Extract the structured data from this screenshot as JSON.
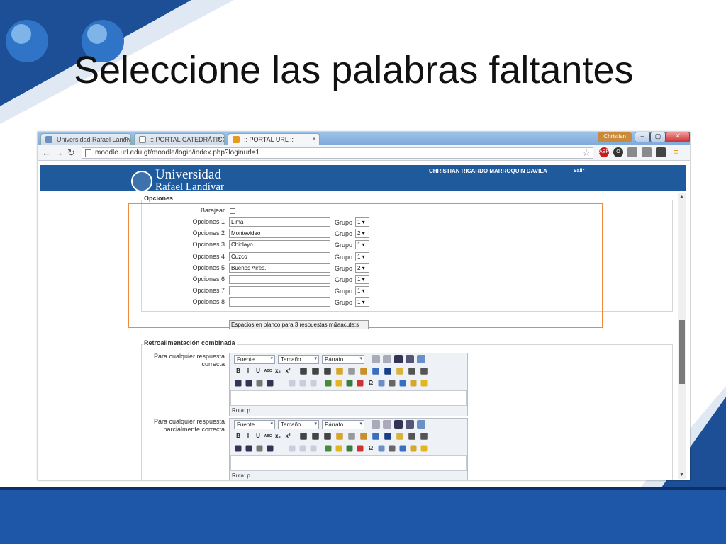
{
  "slide": {
    "title": "Seleccione las palabras faltantes",
    "colors": {
      "band": "#1f57a8",
      "accent_box": "#ee8a3b"
    }
  },
  "browser": {
    "tabs": [
      {
        "label": "Universidad Rafael Landív",
        "icon": "university-favicon-icon"
      },
      {
        "label": ":: PORTAL CATEDRÁTICOS",
        "icon": "page-favicon-icon"
      },
      {
        "label": ":: PORTAL URL ::",
        "icon": "moodle-favicon-icon"
      }
    ],
    "window_user": "Christian",
    "url": "moodle.url.edu.gt/moodle/login/index.php?loginurl=1",
    "extensions": [
      "ABP"
    ]
  },
  "site": {
    "logo_line1": "Universidad",
    "logo_line2": "Rafael Landívar",
    "user_name": "CHRISTIAN RICARDO MARROQUIN DAVILA",
    "logout": "Salir"
  },
  "opciones": {
    "legend": "Opciones",
    "shuffle_label": "Barajear",
    "rows": [
      {
        "label": "Opciones 1",
        "value": "Lima",
        "group_label": "Grupo",
        "group": "1 ▾"
      },
      {
        "label": "Opciones 2",
        "value": "Montevideo",
        "group_label": "Grupo",
        "group": "2 ▾"
      },
      {
        "label": "Opciones 3",
        "value": "Chiclayo",
        "group_label": "Grupo",
        "group": "1 ▾"
      },
      {
        "label": "Opciones 4",
        "value": "Cuzco",
        "group_label": "Grupo",
        "group": "1 ▾"
      },
      {
        "label": "Opciones 5",
        "value": "Buenos Aires.",
        "group_label": "Grupo",
        "group": "2 ▾"
      },
      {
        "label": "Opciones 6",
        "value": "",
        "group_label": "Grupo",
        "group": "1 ▾"
      },
      {
        "label": "Opciones 7",
        "value": "",
        "group_label": "Grupo",
        "group": "1 ▾"
      },
      {
        "label": "Opciones 8",
        "value": "",
        "group_label": "Grupo",
        "group": "1 ▾"
      }
    ],
    "add_blanks_button": "Espacios en blanco para 3 respuestas m&aacute;s"
  },
  "feedback": {
    "legend": "Retroalimentación combinada",
    "editors": [
      {
        "label": "Para cualquier respuesta correcta",
        "font": "Fuente",
        "size": "Tamaño",
        "format": "Párrafo",
        "path": "Ruta: p"
      },
      {
        "label": "Para cualquier respuesta parcialmente correcta",
        "font": "Fuente",
        "size": "Tamaño",
        "format": "Párrafo",
        "path": "Ruta: p"
      }
    ],
    "toolbar_row2": [
      "B",
      "I",
      "U",
      "ABC",
      "x₂",
      "x²"
    ],
    "toolbar_row3": [
      "Ω"
    ]
  }
}
